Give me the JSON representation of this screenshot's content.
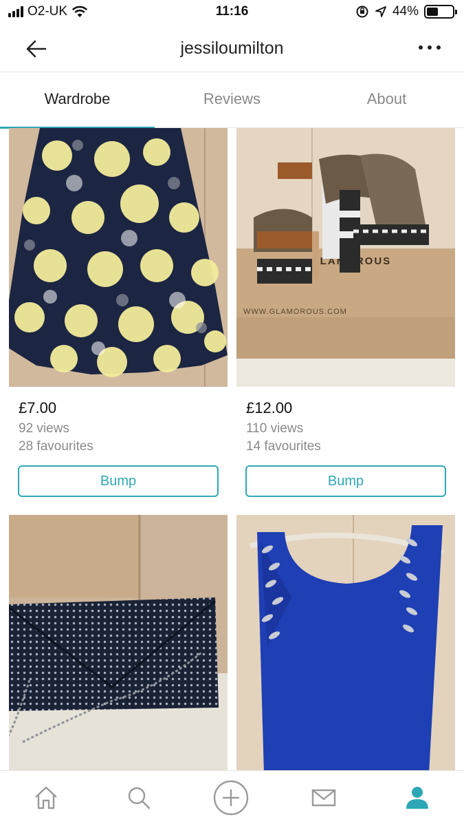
{
  "status_bar": {
    "carrier": "O2-UK",
    "time": "11:16",
    "battery_percent": "44%",
    "battery_level": 0.44
  },
  "header": {
    "username": "jessiloumilton",
    "back_icon": "arrow-left-icon",
    "menu_icon": "more-dots-icon"
  },
  "tabs": [
    {
      "label": "Wardrobe",
      "active": true
    },
    {
      "label": "Reviews",
      "active": false
    },
    {
      "label": "About",
      "active": false
    }
  ],
  "items": [
    {
      "price": "£7.00",
      "views": "92 views",
      "favourites": "28 favourites",
      "bump_label": "Bump",
      "image": "floral-skirt"
    },
    {
      "price": "£12.00",
      "views": "110 views",
      "favourites": "14 favourites",
      "bump_label": "Bump",
      "image": "platform-sandals",
      "box_text_brand": "GLAMOROUS",
      "box_text_url": "WWW.GLAMOROUS.COM"
    },
    {
      "image": "studded-clutch"
    },
    {
      "image": "blue-embellished-top"
    }
  ],
  "colors": {
    "accent": "#2ea7b5",
    "nav_active": "#2ea7b5",
    "nav_inactive": "#9a9a9a"
  },
  "bottom_nav": [
    {
      "icon": "home-icon",
      "active": false
    },
    {
      "icon": "search-icon",
      "active": false
    },
    {
      "icon": "add-icon",
      "active": false
    },
    {
      "icon": "mail-icon",
      "active": false
    },
    {
      "icon": "profile-icon",
      "active": true
    }
  ]
}
